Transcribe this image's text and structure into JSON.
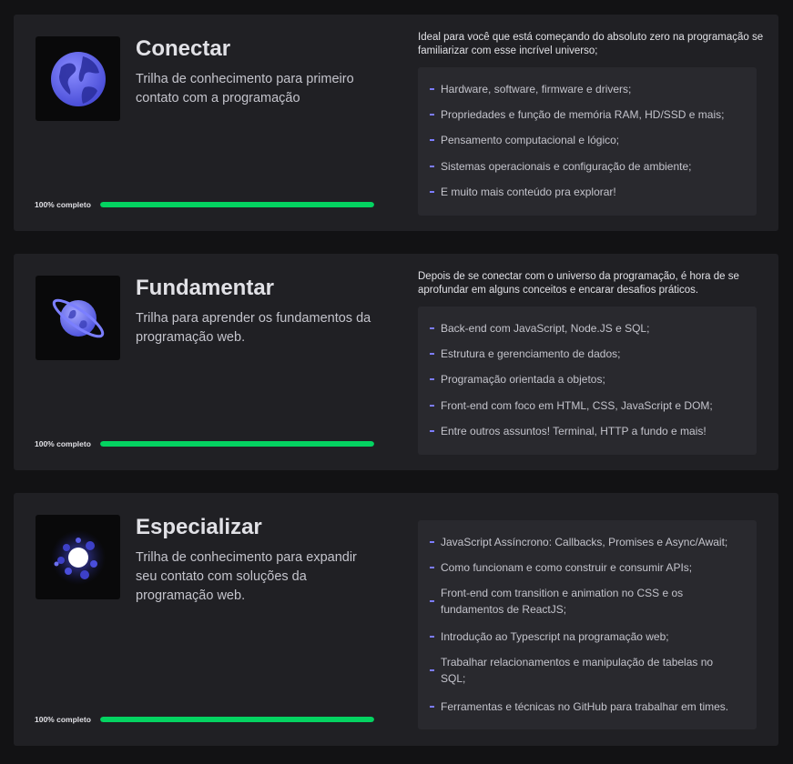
{
  "progress_label": "100% completo",
  "colors": {
    "accent_green": "#04d361",
    "bullet": "#7c7cff",
    "card_bg": "#202024"
  },
  "cards": [
    {
      "title": "Conectar",
      "description": "Trilha de conhecimento para primeiro contato com a programação",
      "icon": "globe-icon",
      "progress_percent": 100,
      "intro": "Ideal para você que está começando do absoluto zero na programação se familiarizar com esse incrível universo;",
      "topics": [
        "Hardware, software, firmware e drivers;",
        "Propriedades e função de memória RAM, HD/SSD e mais;",
        "Pensamento computacional e lógico;",
        "Sistemas operacionais e configuração de ambiente;",
        "E muito mais conteúdo pra explorar!"
      ]
    },
    {
      "title": "Fundamentar",
      "description": "Trilha para aprender os fundamentos da programação web.",
      "icon": "planet-icon",
      "progress_percent": 100,
      "intro": "Depois de se conectar com o universo da programação, é hora de se aprofundar em alguns conceitos e encarar desafios práticos.",
      "topics": [
        "Back-end com JavaScript, Node.JS e SQL;",
        "Estrutura e gerenciamento de dados;",
        "Programação orientada a objetos;",
        "Front-end com foco em HTML, CSS, JavaScript e DOM;",
        "Entre outros assuntos! Terminal, HTTP a fundo e mais!"
      ]
    },
    {
      "title": "Especializar",
      "description": "Trilha de conhecimento para expandir seu contato com soluções da programação web.",
      "icon": "galaxy-icon",
      "progress_percent": 100,
      "intro": "",
      "topics": [
        "JavaScript Assíncrono: Callbacks, Promises e Async/Await;",
        "Como funcionam e como construir e consumir APIs;",
        "Front-end com transition e animation no CSS e os fundamentos de ReactJS;",
        "Introdução ao Typescript na programação web;",
        "Trabalhar relacionamentos e manipulação de tabelas no SQL;",
        "Ferramentas e técnicas no GitHub para trabalhar em times."
      ]
    }
  ]
}
